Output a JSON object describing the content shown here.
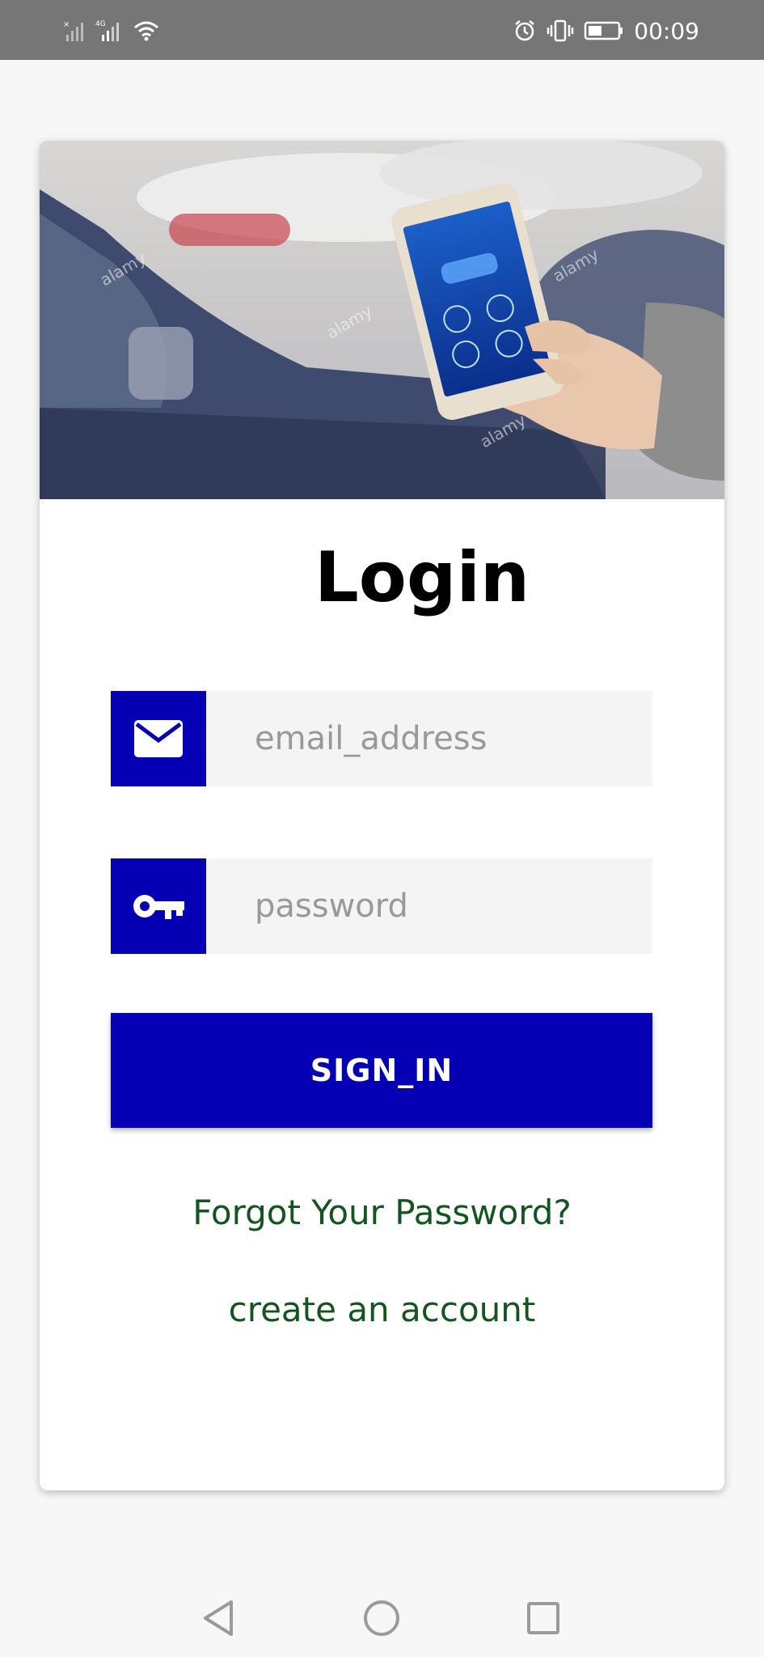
{
  "status_bar": {
    "time": "00:09",
    "network_label": "4G",
    "icons": [
      "no-sim-signal-icon",
      "signal-4g-icon",
      "wifi-icon",
      "alarm-icon",
      "vibrate-icon",
      "battery-icon"
    ]
  },
  "hero": {
    "image": "phone-car-app-photo",
    "watermark": "alamy"
  },
  "login": {
    "title": "Login",
    "email_placeholder": "email_address",
    "email_value": "",
    "password_placeholder": "password",
    "password_value": "",
    "sign_in_label": "SIGN_IN",
    "forgot_label": "Forgot Your Password?",
    "create_label": "create an account"
  },
  "nav_bar": {
    "icons": [
      "back-icon",
      "home-icon",
      "recents-icon"
    ]
  },
  "colors": {
    "accent": "#0500b4",
    "link": "#14541e",
    "status_bar": "#767676",
    "background": "#f7f7f7"
  }
}
